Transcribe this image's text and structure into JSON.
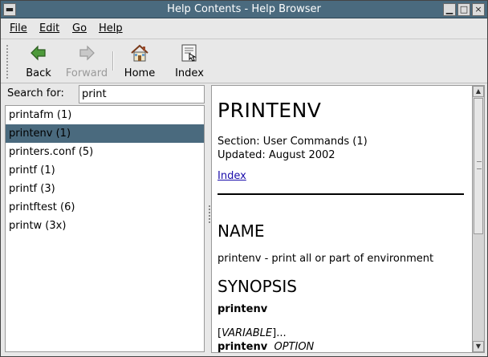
{
  "window": {
    "title": "Help Contents - Help Browser",
    "menu_icon": "window-menu-icon",
    "minimize_icon": "minimize-icon",
    "maximize_icon": "maximize-icon",
    "close_icon": "close-icon"
  },
  "menubar": {
    "items": [
      {
        "label": "File",
        "mnemonic": "F"
      },
      {
        "label": "Edit",
        "mnemonic": "E"
      },
      {
        "label": "Go",
        "mnemonic": "G"
      },
      {
        "label": "Help",
        "mnemonic": "H"
      }
    ]
  },
  "toolbar": {
    "back": {
      "label": "Back",
      "icon": "back-arrow-icon",
      "enabled": true
    },
    "forward": {
      "label": "Forward",
      "icon": "forward-arrow-icon",
      "enabled": false
    },
    "home": {
      "label": "Home",
      "icon": "home-icon",
      "enabled": true
    },
    "index": {
      "label": "Index",
      "icon": "index-icon",
      "enabled": true
    }
  },
  "search": {
    "label": "Search for:",
    "value": "print"
  },
  "results": {
    "items": [
      {
        "label": "printafm (1)",
        "selected": false
      },
      {
        "label": "printenv (1)",
        "selected": true
      },
      {
        "label": "printers.conf (5)",
        "selected": false
      },
      {
        "label": "printf (1)",
        "selected": false
      },
      {
        "label": "printf (3)",
        "selected": false
      },
      {
        "label": "printftest (6)",
        "selected": false
      },
      {
        "label": "printw (3x)",
        "selected": false
      }
    ],
    "selection_color": "#4a6a7e"
  },
  "content": {
    "title": "PRINTENV",
    "section": "Section: User Commands (1)",
    "updated": "Updated: August 2002",
    "index_link": "Index",
    "name_heading": "NAME",
    "name_text": "printenv - print all or part of environment",
    "synopsis_heading": "SYNOPSIS",
    "synopsis_cmd": "printenv",
    "variable_open": "[",
    "variable": "VARIABLE",
    "variable_close": "]...",
    "cmd2": "printenv",
    "option": "OPTION"
  },
  "colors": {
    "titlebar": "#4a6a7e",
    "link": "#1a0dab"
  }
}
